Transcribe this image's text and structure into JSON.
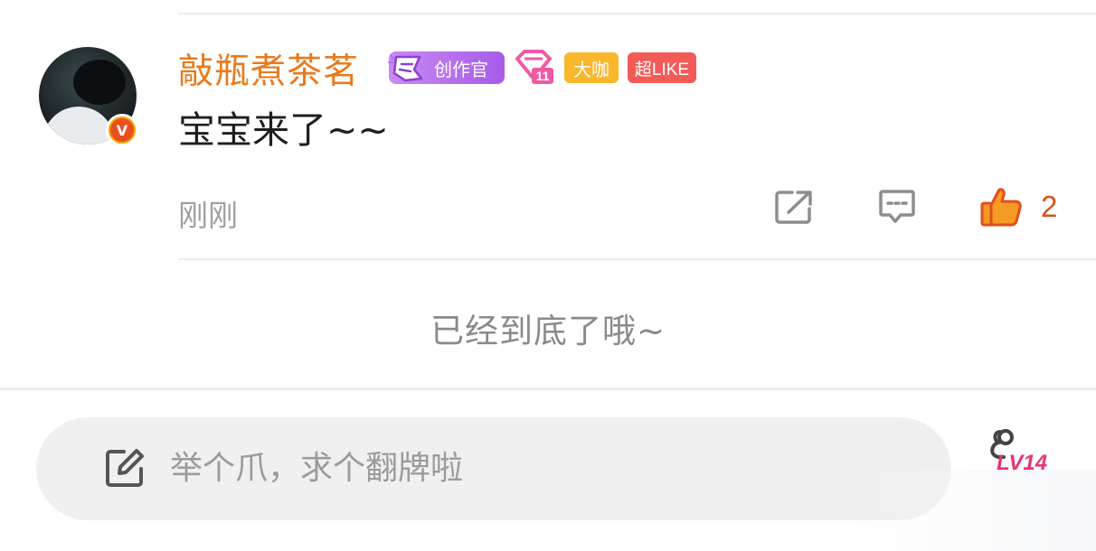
{
  "comment": {
    "username": "敲瓶煮茶茗",
    "badges": {
      "creator_label": "创作官",
      "gem_level": "11",
      "daka_label": "大咖",
      "superlike_label": "超LIKE"
    },
    "text": "宝宝来了~~",
    "timestamp": "刚刚",
    "like_count": "2",
    "colors": {
      "username": "#e97a1c",
      "like": "#d9521e"
    }
  },
  "feed_end": {
    "text": "已经到底了哦~"
  },
  "compose": {
    "placeholder": "举个爪，求个翻牌啦",
    "level": "LV14"
  },
  "icons": [
    "verified-v-icon",
    "creator-badge-icon",
    "gem-level-icon",
    "share-icon",
    "reply-icon",
    "thumbs-up-icon",
    "edit-icon",
    "level-badge-icon"
  ]
}
